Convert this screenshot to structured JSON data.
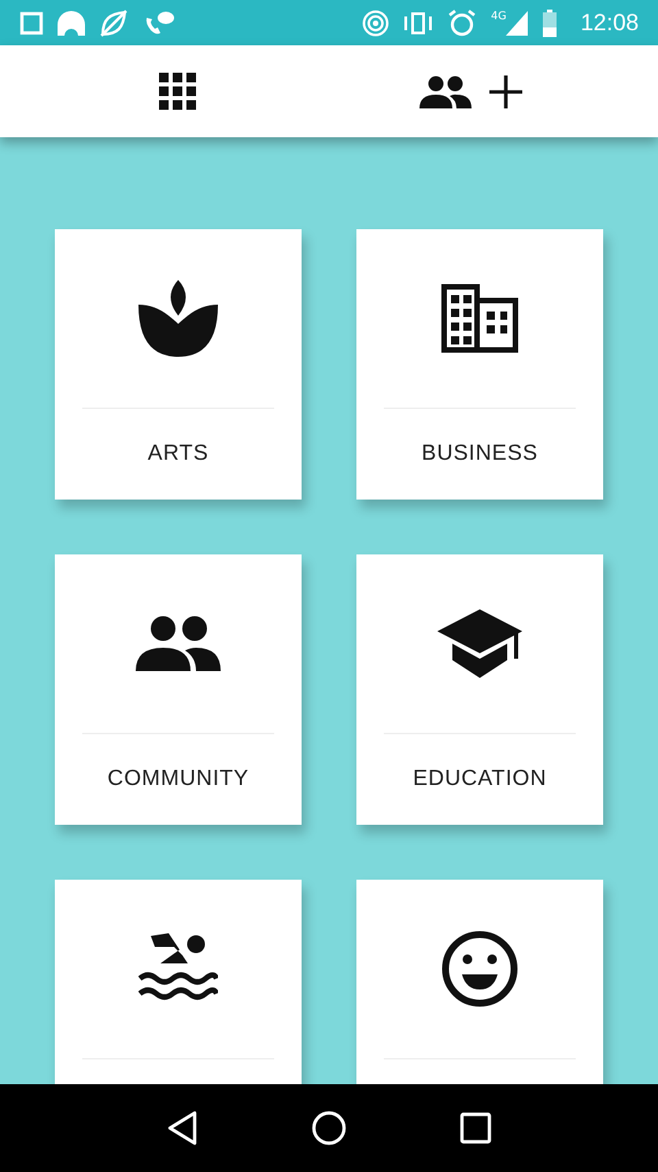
{
  "status_bar": {
    "network_label": "4G",
    "time": "12:08"
  },
  "categories": [
    {
      "kind": "labeled",
      "label": "ARTS"
    },
    {
      "kind": "labeled",
      "label": "BUSINESS"
    },
    {
      "kind": "labeled",
      "label": "COMMUNITY"
    },
    {
      "kind": "labeled",
      "label": "EDUCATION"
    },
    {
      "kind": "clipped"
    },
    {
      "kind": "clipped"
    }
  ]
}
